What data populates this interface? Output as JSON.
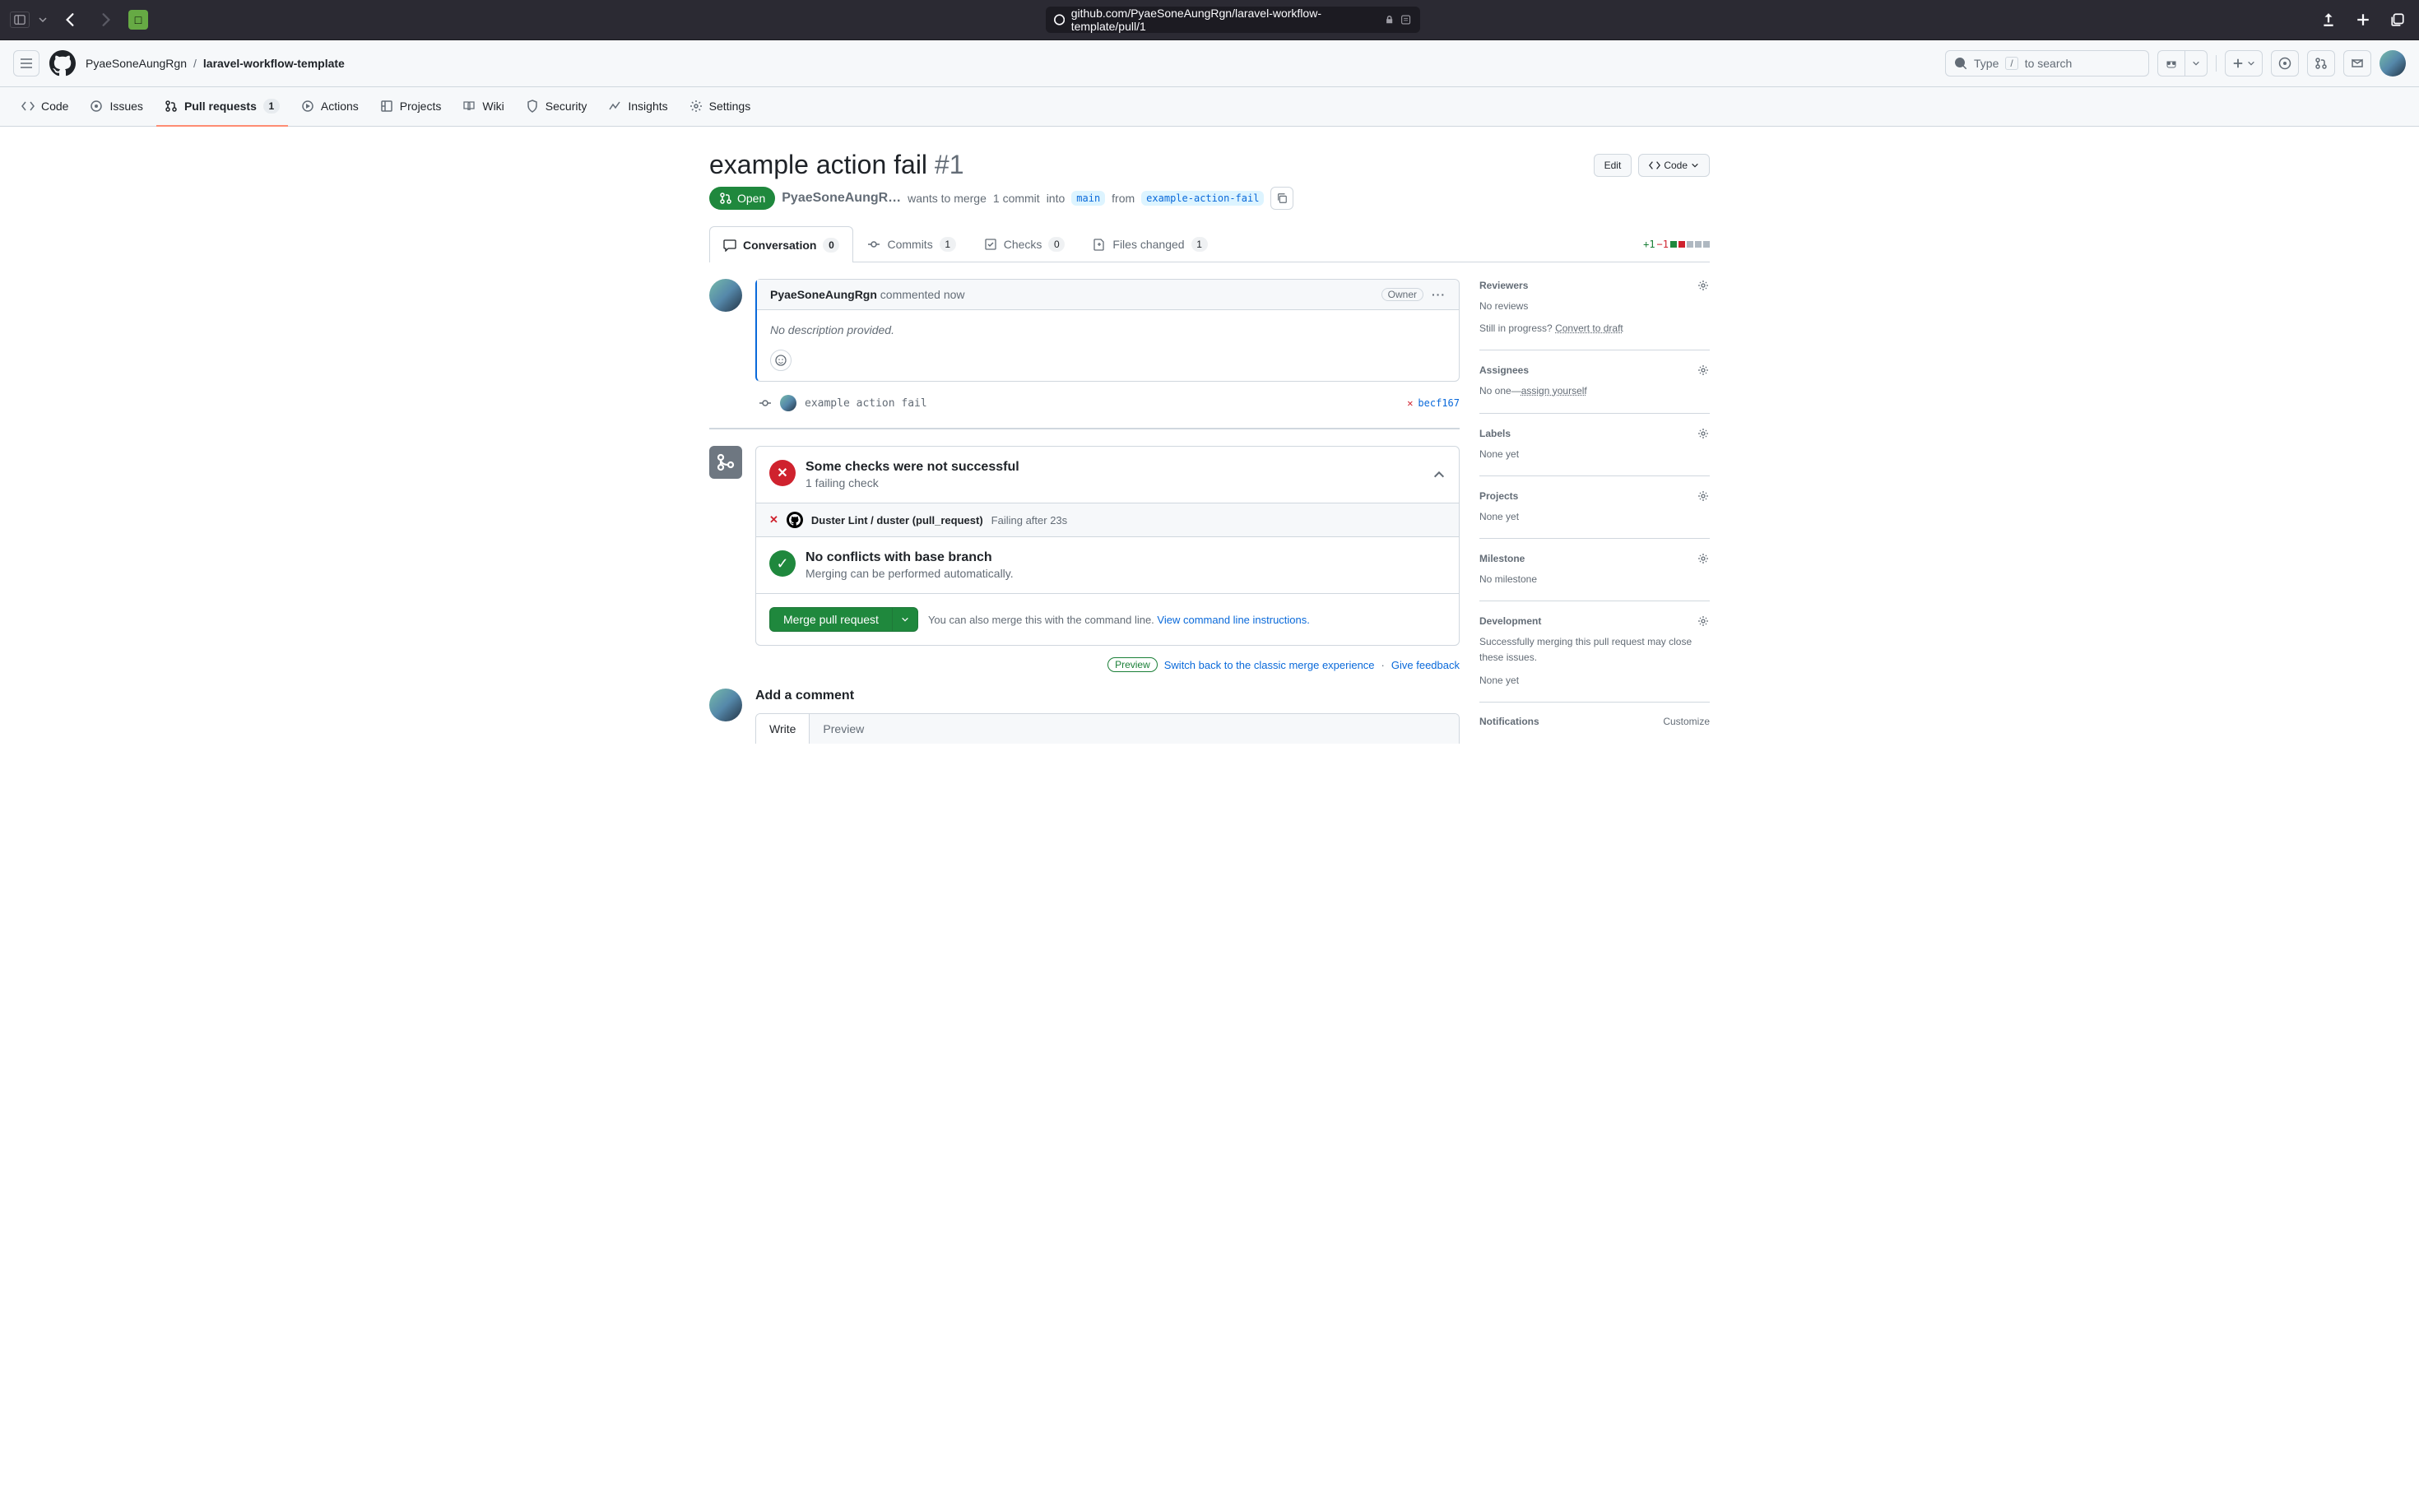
{
  "browser": {
    "url": "github.com/PyaeSoneAungRgn/laravel-workflow-template/pull/1"
  },
  "breadcrumb": {
    "owner": "PyaeSoneAungRgn",
    "repo": "laravel-workflow-template"
  },
  "search": {
    "prefix": "Type",
    "slash": "/",
    "suffix": "to search"
  },
  "repo_nav": {
    "code": "Code",
    "issues": "Issues",
    "pulls": "Pull requests",
    "pulls_count": "1",
    "actions": "Actions",
    "projects": "Projects",
    "wiki": "Wiki",
    "security": "Security",
    "insights": "Insights",
    "settings": "Settings"
  },
  "pr": {
    "title": "example action fail",
    "number": "#1",
    "state": "Open",
    "author_trunc": "PyaeSoneAungR…",
    "wants": "wants to merge",
    "commit_phrase": "1 commit",
    "into": "into",
    "base": "main",
    "from": "from",
    "head": "example-action-fail",
    "edit": "Edit",
    "code": "Code"
  },
  "tabs": {
    "conversation": "Conversation",
    "conv_count": "0",
    "commits": "Commits",
    "commits_count": "1",
    "checks": "Checks",
    "checks_count": "0",
    "files": "Files changed",
    "files_count": "1"
  },
  "diffstat": {
    "plus": "+1",
    "minus": "−1"
  },
  "comment": {
    "author": "PyaeSoneAungRgn",
    "verb": "commented",
    "time": "now",
    "owner": "Owner",
    "body": "No description provided."
  },
  "commit": {
    "msg": "example action fail",
    "sha": "becf167"
  },
  "checks": {
    "title": "Some checks were not successful",
    "subtitle": "1 failing check",
    "row_name": "Duster Lint / duster (pull_request)",
    "row_status": "Failing after 23s"
  },
  "conflicts": {
    "title": "No conflicts with base branch",
    "subtitle": "Merging can be performed automatically."
  },
  "merge": {
    "btn": "Merge pull request",
    "desc1": "You can also merge this with the command line.",
    "link": "View command line instructions."
  },
  "preview": {
    "badge": "Preview",
    "switch": "Switch back to the classic merge experience",
    "feedback": "Give feedback"
  },
  "add_comment": {
    "title": "Add a comment",
    "write": "Write",
    "preview": "Preview"
  },
  "sidebar": {
    "reviewers": {
      "title": "Reviewers",
      "none": "No reviews",
      "draft_q": "Still in progress?",
      "draft_link": "Convert to draft"
    },
    "assignees": {
      "title": "Assignees",
      "none": "No one—",
      "assign": "assign yourself"
    },
    "labels": {
      "title": "Labels",
      "none": "None yet"
    },
    "projects": {
      "title": "Projects",
      "none": "None yet"
    },
    "milestone": {
      "title": "Milestone",
      "none": "No milestone"
    },
    "development": {
      "title": "Development",
      "desc": "Successfully merging this pull request may close these issues.",
      "none": "None yet"
    },
    "notifications": {
      "title": "Notifications",
      "customize": "Customize"
    }
  }
}
